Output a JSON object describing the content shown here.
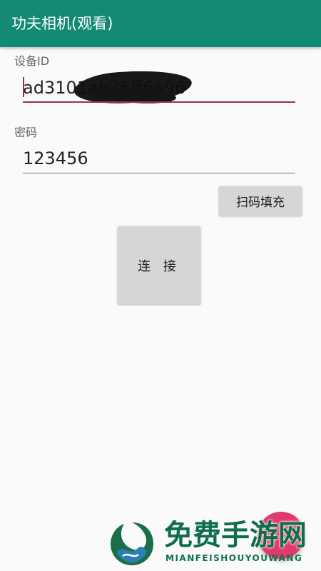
{
  "app_bar": {
    "title": "功夫相机(观看)",
    "color": "#138a72"
  },
  "form": {
    "device_id": {
      "label": "设备ID",
      "value": "ad3101ab36ff6a96"
    },
    "password": {
      "label": "密码",
      "value": "123456"
    }
  },
  "buttons": {
    "scan_fill": "扫码填充",
    "connect": "连 接"
  },
  "fab": {
    "color": "#e03a6d"
  },
  "watermark": {
    "logo_icon": "leaf-wave-logo",
    "title": "免费手游网",
    "subtitle": "MIANFEISHOUYOUWANG"
  }
}
